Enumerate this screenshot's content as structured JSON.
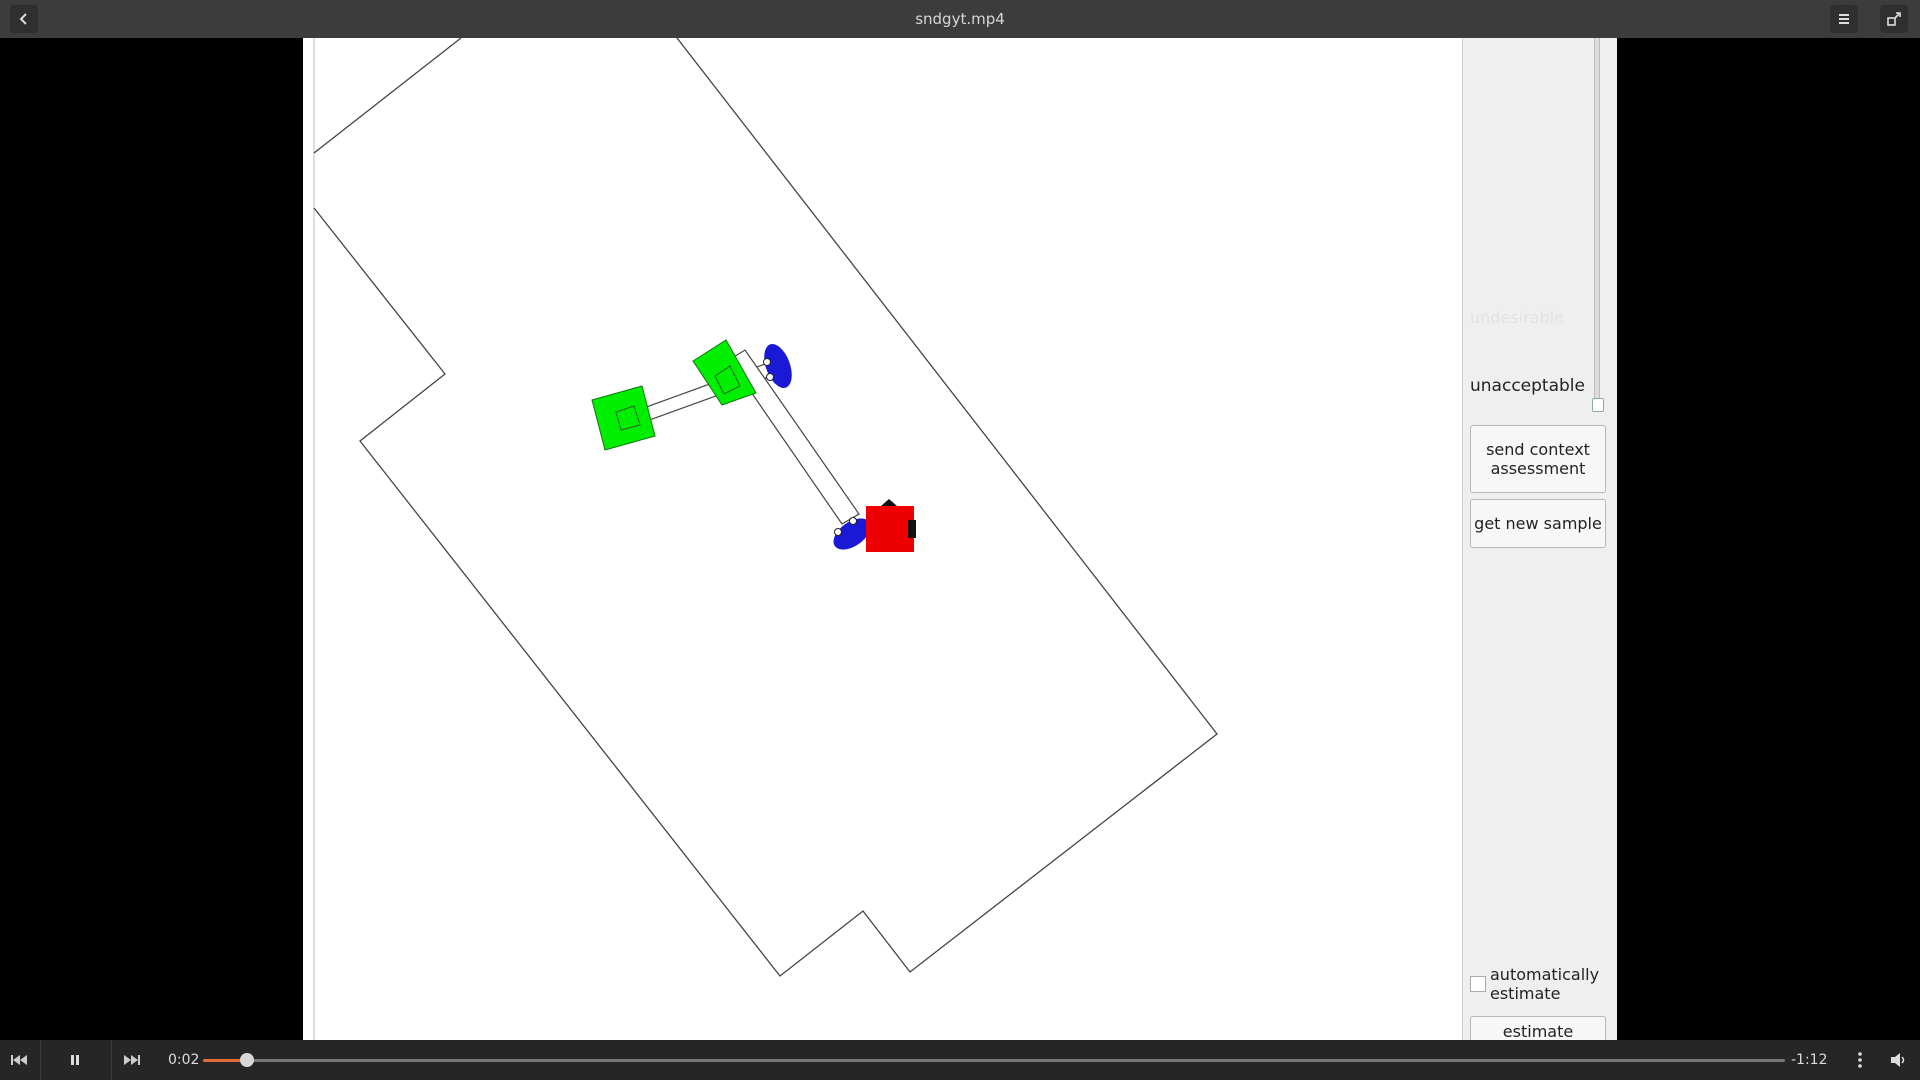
{
  "window": {
    "title": "sndgyt.mp4",
    "back_icon": "chevron-left-icon",
    "menu_icon": "hamburger-menu-icon",
    "restore_icon": "unfullscreen-icon"
  },
  "panel": {
    "faded_label": "undesirable",
    "slider_label": "unacceptable",
    "send_button": "send context assessment",
    "new_sample_button": "get new sample",
    "auto_estimate_label": "automatically estimate",
    "auto_estimate_checked": false,
    "estimate_button": "estimate"
  },
  "scene": {
    "robot_color": "#ff0000",
    "person_color": "#0000ff",
    "object_color": "#00ff00",
    "outline_color": "#444444"
  },
  "player": {
    "elapsed": "0:02",
    "remaining": "-1:12",
    "progress": 0.028,
    "accent": "#e06a3a",
    "prev_icon": "skip-previous-icon",
    "play_pause_icon": "pause-icon",
    "next_icon": "skip-next-icon",
    "more_icon": "more-vertical-icon",
    "volume_icon": "volume-icon"
  }
}
